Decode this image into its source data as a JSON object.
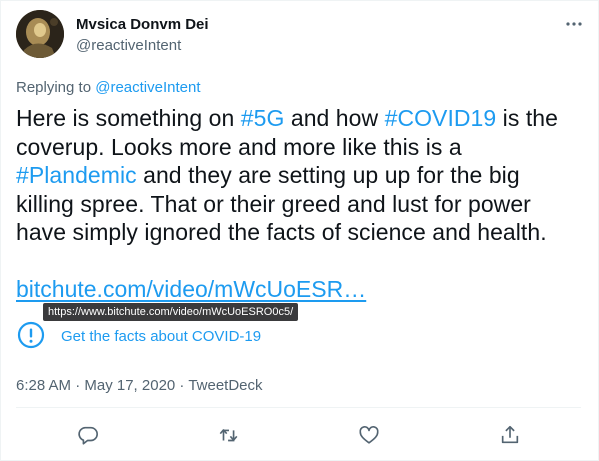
{
  "author": {
    "name": "Mvsica Donvm Dei",
    "handle": "@reactiveIntent"
  },
  "reply": {
    "prefix": "Replying to ",
    "mention": "@reactiveIntent"
  },
  "tweet": {
    "t1": "Here is something on ",
    "tag1": "#5G",
    "t2": " and how ",
    "tag2": "#COVID19",
    "t3": " is the coverup. Looks more and more like this is a ",
    "tag3": "#Plandemic",
    "t4": " and they are setting up up for the big killing spree. That or their greed and lust for power have simply ignored the facts of science and health.",
    "link": "bitchute.com/video/mWcUoESR…"
  },
  "tooltip": "https://www.bitchute.com/video/mWcUoESRO0c5/",
  "facts_notice": "Get the facts about COVID-19",
  "meta": "6:28 AM · May 17, 2020 · TweetDeck",
  "icons": {
    "more": "more-icon",
    "info": "info-icon",
    "reply": "reply-icon",
    "retweet": "retweet-icon",
    "like": "like-icon",
    "share": "share-icon"
  },
  "colors": {
    "accent": "#1d9bf0",
    "text": "#0f1419",
    "secondary": "#536471"
  }
}
